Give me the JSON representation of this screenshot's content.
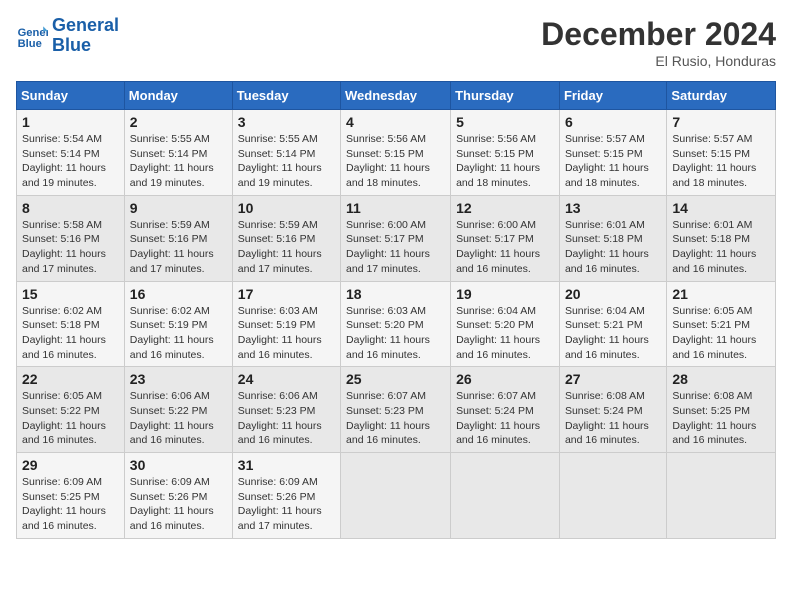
{
  "header": {
    "logo_line1": "General",
    "logo_line2": "Blue",
    "month": "December 2024",
    "location": "El Rusio, Honduras"
  },
  "weekdays": [
    "Sunday",
    "Monday",
    "Tuesday",
    "Wednesday",
    "Thursday",
    "Friday",
    "Saturday"
  ],
  "weeks": [
    [
      {
        "day": "1",
        "info": "Sunrise: 5:54 AM\nSunset: 5:14 PM\nDaylight: 11 hours\nand 19 minutes."
      },
      {
        "day": "2",
        "info": "Sunrise: 5:55 AM\nSunset: 5:14 PM\nDaylight: 11 hours\nand 19 minutes."
      },
      {
        "day": "3",
        "info": "Sunrise: 5:55 AM\nSunset: 5:14 PM\nDaylight: 11 hours\nand 19 minutes."
      },
      {
        "day": "4",
        "info": "Sunrise: 5:56 AM\nSunset: 5:15 PM\nDaylight: 11 hours\nand 18 minutes."
      },
      {
        "day": "5",
        "info": "Sunrise: 5:56 AM\nSunset: 5:15 PM\nDaylight: 11 hours\nand 18 minutes."
      },
      {
        "day": "6",
        "info": "Sunrise: 5:57 AM\nSunset: 5:15 PM\nDaylight: 11 hours\nand 18 minutes."
      },
      {
        "day": "7",
        "info": "Sunrise: 5:57 AM\nSunset: 5:15 PM\nDaylight: 11 hours\nand 18 minutes."
      }
    ],
    [
      {
        "day": "8",
        "info": "Sunrise: 5:58 AM\nSunset: 5:16 PM\nDaylight: 11 hours\nand 17 minutes."
      },
      {
        "day": "9",
        "info": "Sunrise: 5:59 AM\nSunset: 5:16 PM\nDaylight: 11 hours\nand 17 minutes."
      },
      {
        "day": "10",
        "info": "Sunrise: 5:59 AM\nSunset: 5:16 PM\nDaylight: 11 hours\nand 17 minutes."
      },
      {
        "day": "11",
        "info": "Sunrise: 6:00 AM\nSunset: 5:17 PM\nDaylight: 11 hours\nand 17 minutes."
      },
      {
        "day": "12",
        "info": "Sunrise: 6:00 AM\nSunset: 5:17 PM\nDaylight: 11 hours\nand 16 minutes."
      },
      {
        "day": "13",
        "info": "Sunrise: 6:01 AM\nSunset: 5:18 PM\nDaylight: 11 hours\nand 16 minutes."
      },
      {
        "day": "14",
        "info": "Sunrise: 6:01 AM\nSunset: 5:18 PM\nDaylight: 11 hours\nand 16 minutes."
      }
    ],
    [
      {
        "day": "15",
        "info": "Sunrise: 6:02 AM\nSunset: 5:18 PM\nDaylight: 11 hours\nand 16 minutes."
      },
      {
        "day": "16",
        "info": "Sunrise: 6:02 AM\nSunset: 5:19 PM\nDaylight: 11 hours\nand 16 minutes."
      },
      {
        "day": "17",
        "info": "Sunrise: 6:03 AM\nSunset: 5:19 PM\nDaylight: 11 hours\nand 16 minutes."
      },
      {
        "day": "18",
        "info": "Sunrise: 6:03 AM\nSunset: 5:20 PM\nDaylight: 11 hours\nand 16 minutes."
      },
      {
        "day": "19",
        "info": "Sunrise: 6:04 AM\nSunset: 5:20 PM\nDaylight: 11 hours\nand 16 minutes."
      },
      {
        "day": "20",
        "info": "Sunrise: 6:04 AM\nSunset: 5:21 PM\nDaylight: 11 hours\nand 16 minutes."
      },
      {
        "day": "21",
        "info": "Sunrise: 6:05 AM\nSunset: 5:21 PM\nDaylight: 11 hours\nand 16 minutes."
      }
    ],
    [
      {
        "day": "22",
        "info": "Sunrise: 6:05 AM\nSunset: 5:22 PM\nDaylight: 11 hours\nand 16 minutes."
      },
      {
        "day": "23",
        "info": "Sunrise: 6:06 AM\nSunset: 5:22 PM\nDaylight: 11 hours\nand 16 minutes."
      },
      {
        "day": "24",
        "info": "Sunrise: 6:06 AM\nSunset: 5:23 PM\nDaylight: 11 hours\nand 16 minutes."
      },
      {
        "day": "25",
        "info": "Sunrise: 6:07 AM\nSunset: 5:23 PM\nDaylight: 11 hours\nand 16 minutes."
      },
      {
        "day": "26",
        "info": "Sunrise: 6:07 AM\nSunset: 5:24 PM\nDaylight: 11 hours\nand 16 minutes."
      },
      {
        "day": "27",
        "info": "Sunrise: 6:08 AM\nSunset: 5:24 PM\nDaylight: 11 hours\nand 16 minutes."
      },
      {
        "day": "28",
        "info": "Sunrise: 6:08 AM\nSunset: 5:25 PM\nDaylight: 11 hours\nand 16 minutes."
      }
    ],
    [
      {
        "day": "29",
        "info": "Sunrise: 6:09 AM\nSunset: 5:25 PM\nDaylight: 11 hours\nand 16 minutes."
      },
      {
        "day": "30",
        "info": "Sunrise: 6:09 AM\nSunset: 5:26 PM\nDaylight: 11 hours\nand 16 minutes."
      },
      {
        "day": "31",
        "info": "Sunrise: 6:09 AM\nSunset: 5:26 PM\nDaylight: 11 hours\nand 17 minutes."
      },
      null,
      null,
      null,
      null
    ]
  ]
}
